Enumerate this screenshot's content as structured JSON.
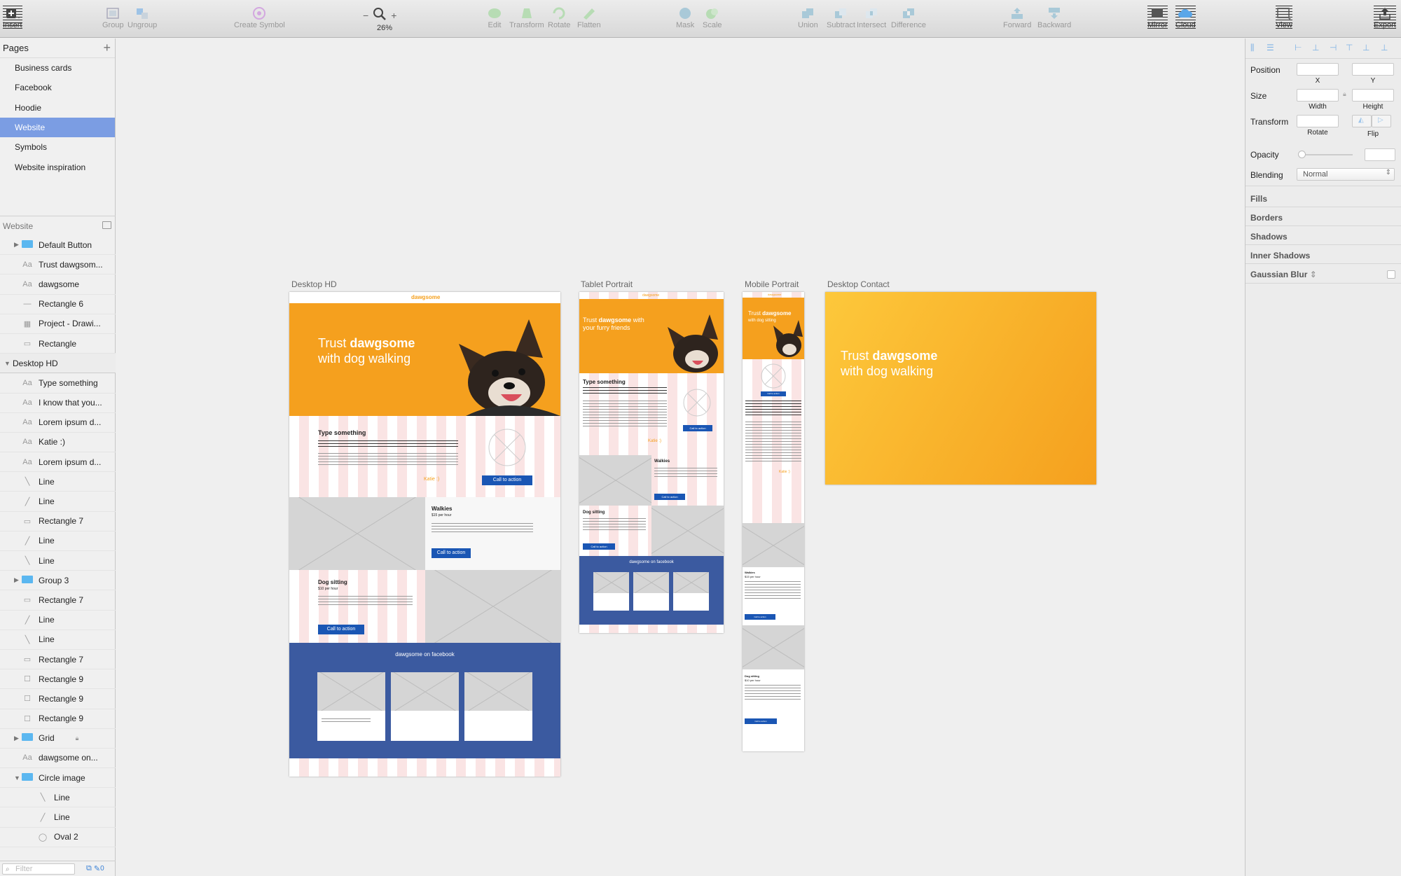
{
  "toolbar": {
    "insert": "Insert",
    "group": "Group",
    "ungroup": "Ungroup",
    "create_symbol": "Create Symbol",
    "zoom": "26%",
    "edit": "Edit",
    "transform": "Transform",
    "rotate": "Rotate",
    "flatten": "Flatten",
    "mask": "Mask",
    "scale": "Scale",
    "union": "Union",
    "subtract": "Subtract",
    "intersect": "Intersect",
    "difference": "Difference",
    "forward": "Forward",
    "backward": "Backward",
    "mirror": "Mirror",
    "cloud": "Cloud",
    "view": "View",
    "export": "Export"
  },
  "pages": {
    "header": "Pages",
    "items": [
      "Business cards",
      "Facebook",
      "Hoodie",
      "Website",
      "Symbols",
      "Website inspiration"
    ],
    "selected": "Website"
  },
  "layers_header": "Website",
  "layers": [
    {
      "label": "Default Button",
      "icon": "folder-icon",
      "tri": "▶",
      "indent": 1
    },
    {
      "label": "Trust dawgsom...",
      "icon": "text-icon",
      "indent": 1
    },
    {
      "label": "dawgsome",
      "icon": "text-icon",
      "indent": 1
    },
    {
      "label": "Rectangle 6",
      "icon": "line-icon",
      "indent": 1
    },
    {
      "label": "Project - Drawi...",
      "icon": "image-icon",
      "indent": 1
    },
    {
      "label": "Rectangle",
      "icon": "rectangle-icon",
      "indent": 1
    },
    {
      "label": "Desktop HD",
      "icon": "artboard",
      "tri": "▼",
      "indent": 0
    },
    {
      "label": "Type something",
      "icon": "text-icon",
      "indent": 1
    },
    {
      "label": "I know that you...",
      "icon": "text-icon",
      "indent": 1
    },
    {
      "label": "Lorem ipsum d...",
      "icon": "text-icon",
      "indent": 1
    },
    {
      "label": "Katie :)",
      "icon": "text-icon",
      "indent": 1
    },
    {
      "label": "Lorem ipsum d...",
      "icon": "text-icon",
      "indent": 1
    },
    {
      "label": "Line",
      "icon": "line-icon",
      "indent": 1
    },
    {
      "label": "Line",
      "icon": "line-icon",
      "indent": 1
    },
    {
      "label": "Rectangle 7",
      "icon": "rectangle-icon",
      "indent": 1
    },
    {
      "label": "Line",
      "icon": "line-icon",
      "indent": 1
    },
    {
      "label": "Line",
      "icon": "line-icon",
      "indent": 1
    },
    {
      "label": "Group 3",
      "icon": "folder-icon",
      "tri": "▶",
      "indent": 1
    },
    {
      "label": "Rectangle 7",
      "icon": "rectangle-icon",
      "indent": 1
    },
    {
      "label": "Line",
      "icon": "line-icon",
      "indent": 1
    },
    {
      "label": "Line",
      "icon": "line-icon",
      "indent": 1
    },
    {
      "label": "Rectangle 7",
      "icon": "rectangle-icon",
      "indent": 1
    },
    {
      "label": "Rectangle 9",
      "icon": "square-icon",
      "indent": 1
    },
    {
      "label": "Rectangle 9",
      "icon": "square-icon",
      "indent": 1
    },
    {
      "label": "Rectangle 9",
      "icon": "square-icon",
      "indent": 1
    },
    {
      "label": "Grid",
      "icon": "folder-icon",
      "tri": "▶",
      "indent": 1,
      "locked": true
    },
    {
      "label": "dawgsome on...",
      "icon": "text-icon",
      "indent": 1
    },
    {
      "label": "Circle image",
      "icon": "folder-icon",
      "tri": "▼",
      "indent": 1
    },
    {
      "label": "Line",
      "icon": "line-icon",
      "indent": 2
    },
    {
      "label": "Line",
      "icon": "line-icon",
      "indent": 2
    },
    {
      "label": "Oval 2",
      "icon": "oval-icon",
      "indent": 2
    }
  ],
  "filter_placeholder": "Filter",
  "filter_count": "0",
  "inspector": {
    "position": "Position",
    "x": "X",
    "y": "Y",
    "size": "Size",
    "width": "Width",
    "height": "Height",
    "transform": "Transform",
    "rotate": "Rotate",
    "flip": "Flip",
    "opacity": "Opacity",
    "blending": "Blending",
    "blend_value": "Normal",
    "sections": [
      "Fills",
      "Borders",
      "Shadows",
      "Inner Shadows",
      "Gaussian Blur"
    ]
  },
  "artboards": {
    "desktop_hd": {
      "label": "Desktop HD",
      "logo": "dawgsome",
      "hero_a": "Trust ",
      "hero_b": "dawgsome",
      "hero_c": "with dog walking",
      "type_something": "Type something",
      "katie": "Katie :)",
      "cta": "Call to action",
      "walkies": "Walkies",
      "walkies_price": "$15 per hour",
      "dog_sitting": "Dog sitting",
      "sitting_price": "$10 per hour",
      "facebook": "dawgsome on facebook"
    },
    "tablet": {
      "label": "Tablet Portrait",
      "logo": "dawgsome",
      "hero_a": "Trust ",
      "hero_b": "dawgsome",
      "hero_c": " with",
      "hero_d": "your furry friends",
      "type_something": "Type something",
      "katie": "Katie :)",
      "walkies": "Walkies",
      "dog_sitting": "Dog sitting",
      "cta": "Call to action",
      "facebook": "dawgsome on facebook"
    },
    "mobile": {
      "label": "Mobile Portrait",
      "logo": "dawgsome",
      "hero_a": "Trust ",
      "hero_b": "dawgsome",
      "hero_c": "with dog sitting",
      "katie": "Katie :)",
      "walkies": "Walkies",
      "walkies_price": "$15 per hour",
      "dog_sitting": "Dog sitting",
      "sitting_price": "$10 per hour",
      "cta": "Call to action"
    },
    "contact": {
      "label": "Desktop Contact",
      "hero_a": "Trust ",
      "hero_b": "dawgsome",
      "hero_c": "with dog walking"
    }
  },
  "colors": {
    "accent": "#f5a01e",
    "selection": "#7b9de3",
    "button": "#1a56b4",
    "facebook": "#3b5aa0"
  }
}
